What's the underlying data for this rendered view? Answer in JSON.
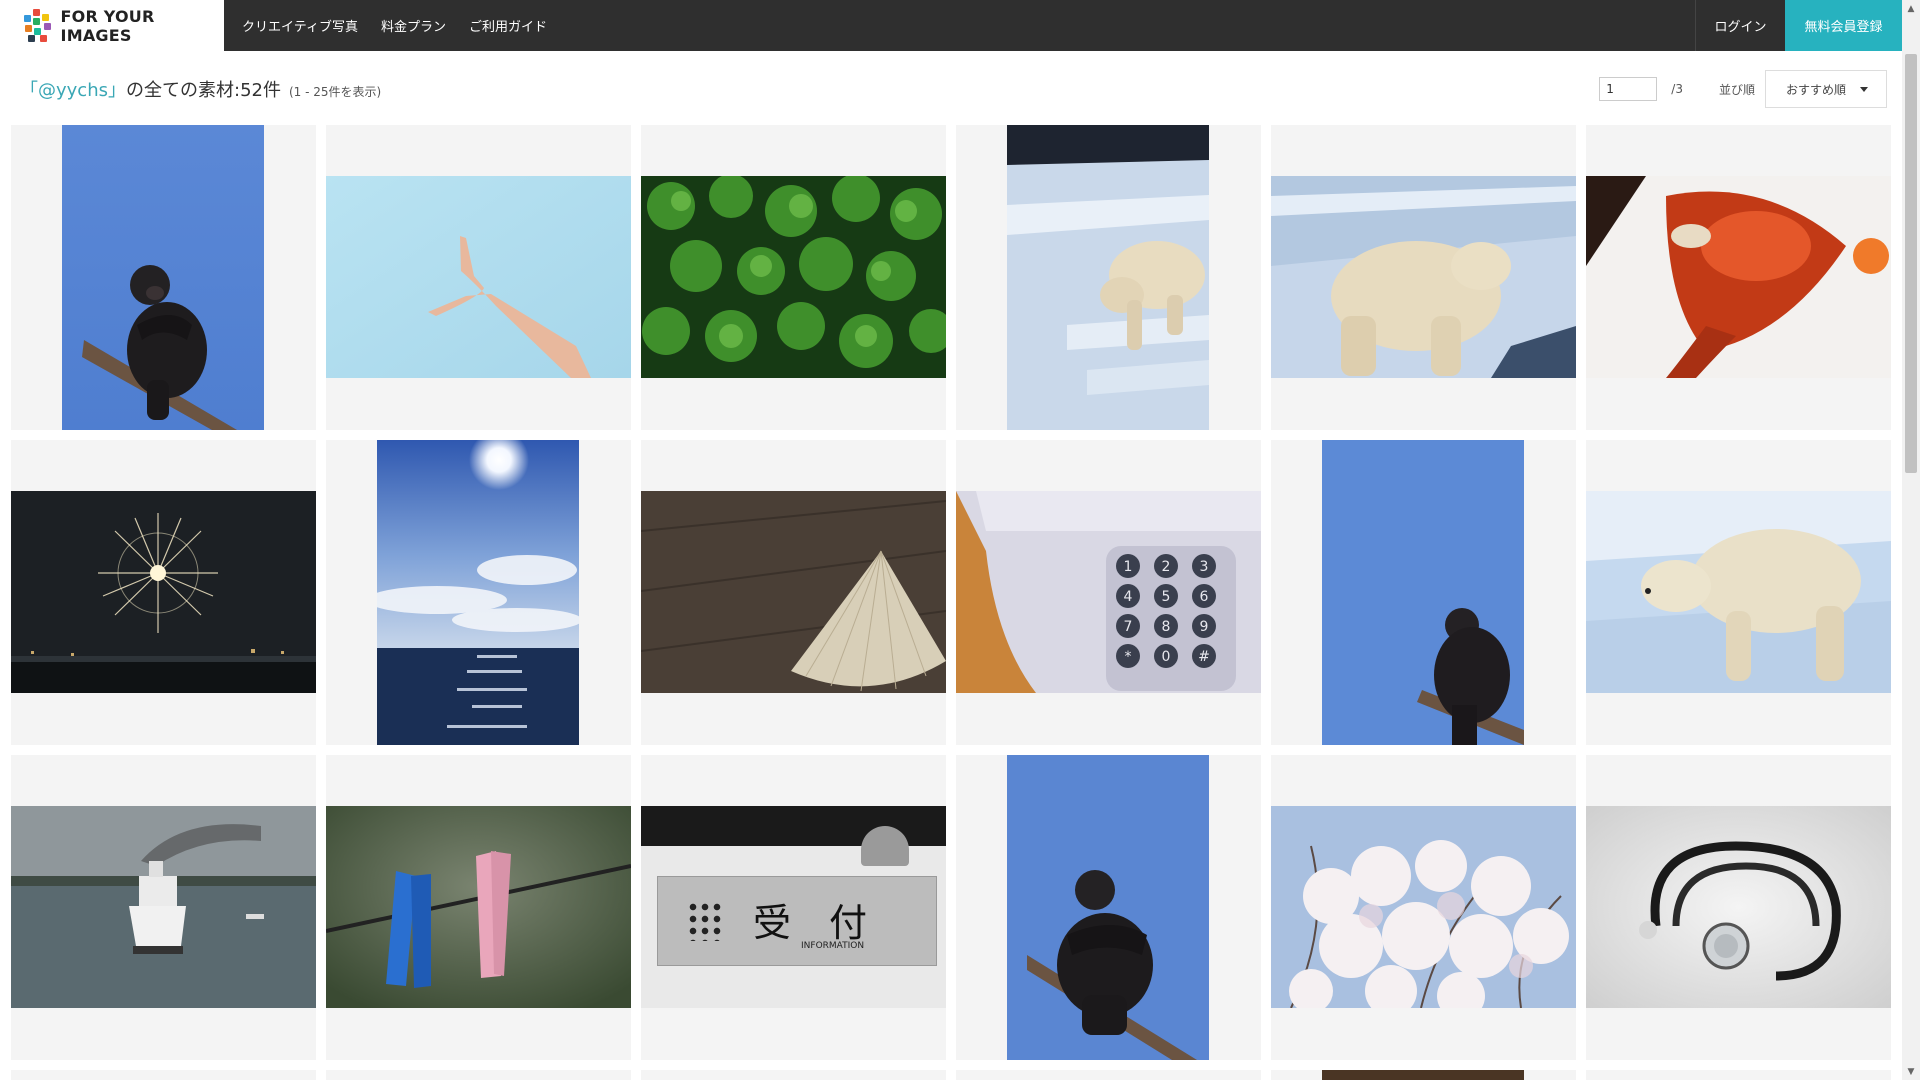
{
  "header": {
    "logo_text": "FOR YOUR IMAGES",
    "nav": [
      "クリエイティブ写真",
      "料金プラン",
      "ご利用ガイド"
    ],
    "login": "ログイン",
    "register": "無料会員登録"
  },
  "title": {
    "user": "「@yychs」",
    "main": "の全ての素材:52件",
    "range": "(1 - 25件を表示)"
  },
  "pager": {
    "current": "1",
    "total": "/3",
    "sort_label": "並び順",
    "sort_value": "おすすめ順"
  },
  "photos": [
    {
      "label": "chimpanzee-on-branch",
      "orient": "portrait"
    },
    {
      "label": "hand-against-sky",
      "orient": "landscape"
    },
    {
      "label": "coriander-leaves",
      "orient": "landscape"
    },
    {
      "label": "polar-bear-on-steps",
      "orient": "portrait"
    },
    {
      "label": "polar-bear-standing",
      "orient": "landscape"
    },
    {
      "label": "lobster-dish",
      "orient": "landscape"
    },
    {
      "label": "fireworks-night",
      "orient": "landscape"
    },
    {
      "label": "sun-over-sea",
      "orient": "portrait"
    },
    {
      "label": "straw-hat-on-wood",
      "orient": "landscape"
    },
    {
      "label": "telephone-keypad",
      "orient": "landscape"
    },
    {
      "label": "chimpanzee-blue-sky",
      "orient": "portrait"
    },
    {
      "label": "polar-bear-walking",
      "orient": "landscape"
    },
    {
      "label": "ferry-ship",
      "orient": "landscape"
    },
    {
      "label": "clothespins",
      "orient": "landscape"
    },
    {
      "label": "reception-sign",
      "orient": "landscape"
    },
    {
      "label": "chimpanzee-sitting",
      "orient": "portrait"
    },
    {
      "label": "cherry-blossoms",
      "orient": "landscape"
    },
    {
      "label": "stethoscope",
      "orient": "landscape"
    }
  ],
  "reception_sign": {
    "kanji": "受　付",
    "sub": "INFORMATION"
  },
  "phone_keys": [
    "1",
    "2",
    "3",
    "4",
    "5",
    "6",
    "7",
    "8",
    "9",
    "*",
    "0",
    "#"
  ]
}
